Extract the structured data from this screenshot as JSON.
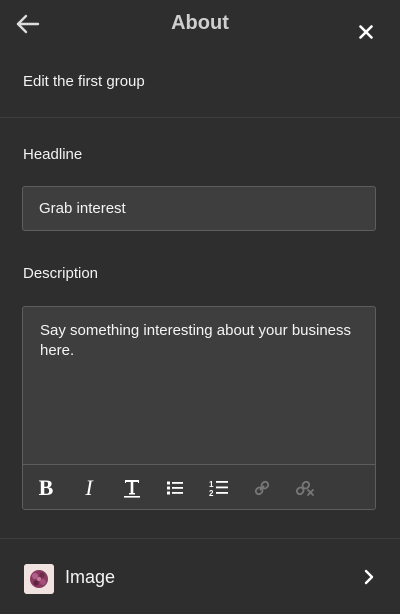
{
  "header": {
    "title": "About",
    "back_icon": "arrow-left-icon",
    "close_icon": "close-icon"
  },
  "subtitle": "Edit the first group",
  "headline": {
    "label": "Headline",
    "value": "Grab interest"
  },
  "description": {
    "label": "Description",
    "text": "Say something interesting about your business here.",
    "toolbar": {
      "bold": "B",
      "italic": "I",
      "text_format_icon": "text-format-icon",
      "bulleted_list_icon": "bulleted-list-icon",
      "numbered_list_icon": "numbered-list-icon",
      "link_icon": "link-icon",
      "unlink_icon": "unlink-icon"
    }
  },
  "image_row": {
    "label": "Image",
    "thumbnail_icon": "image-thumbnail",
    "chevron_icon": "chevron-right-icon"
  },
  "colors": {
    "background": "#2e2e2e",
    "field_background": "#3e3e3e",
    "field_border": "#5e5e5e",
    "text": "#f4f4f4",
    "title_text": "#cfcfcf",
    "disabled_icon": "#777777"
  }
}
